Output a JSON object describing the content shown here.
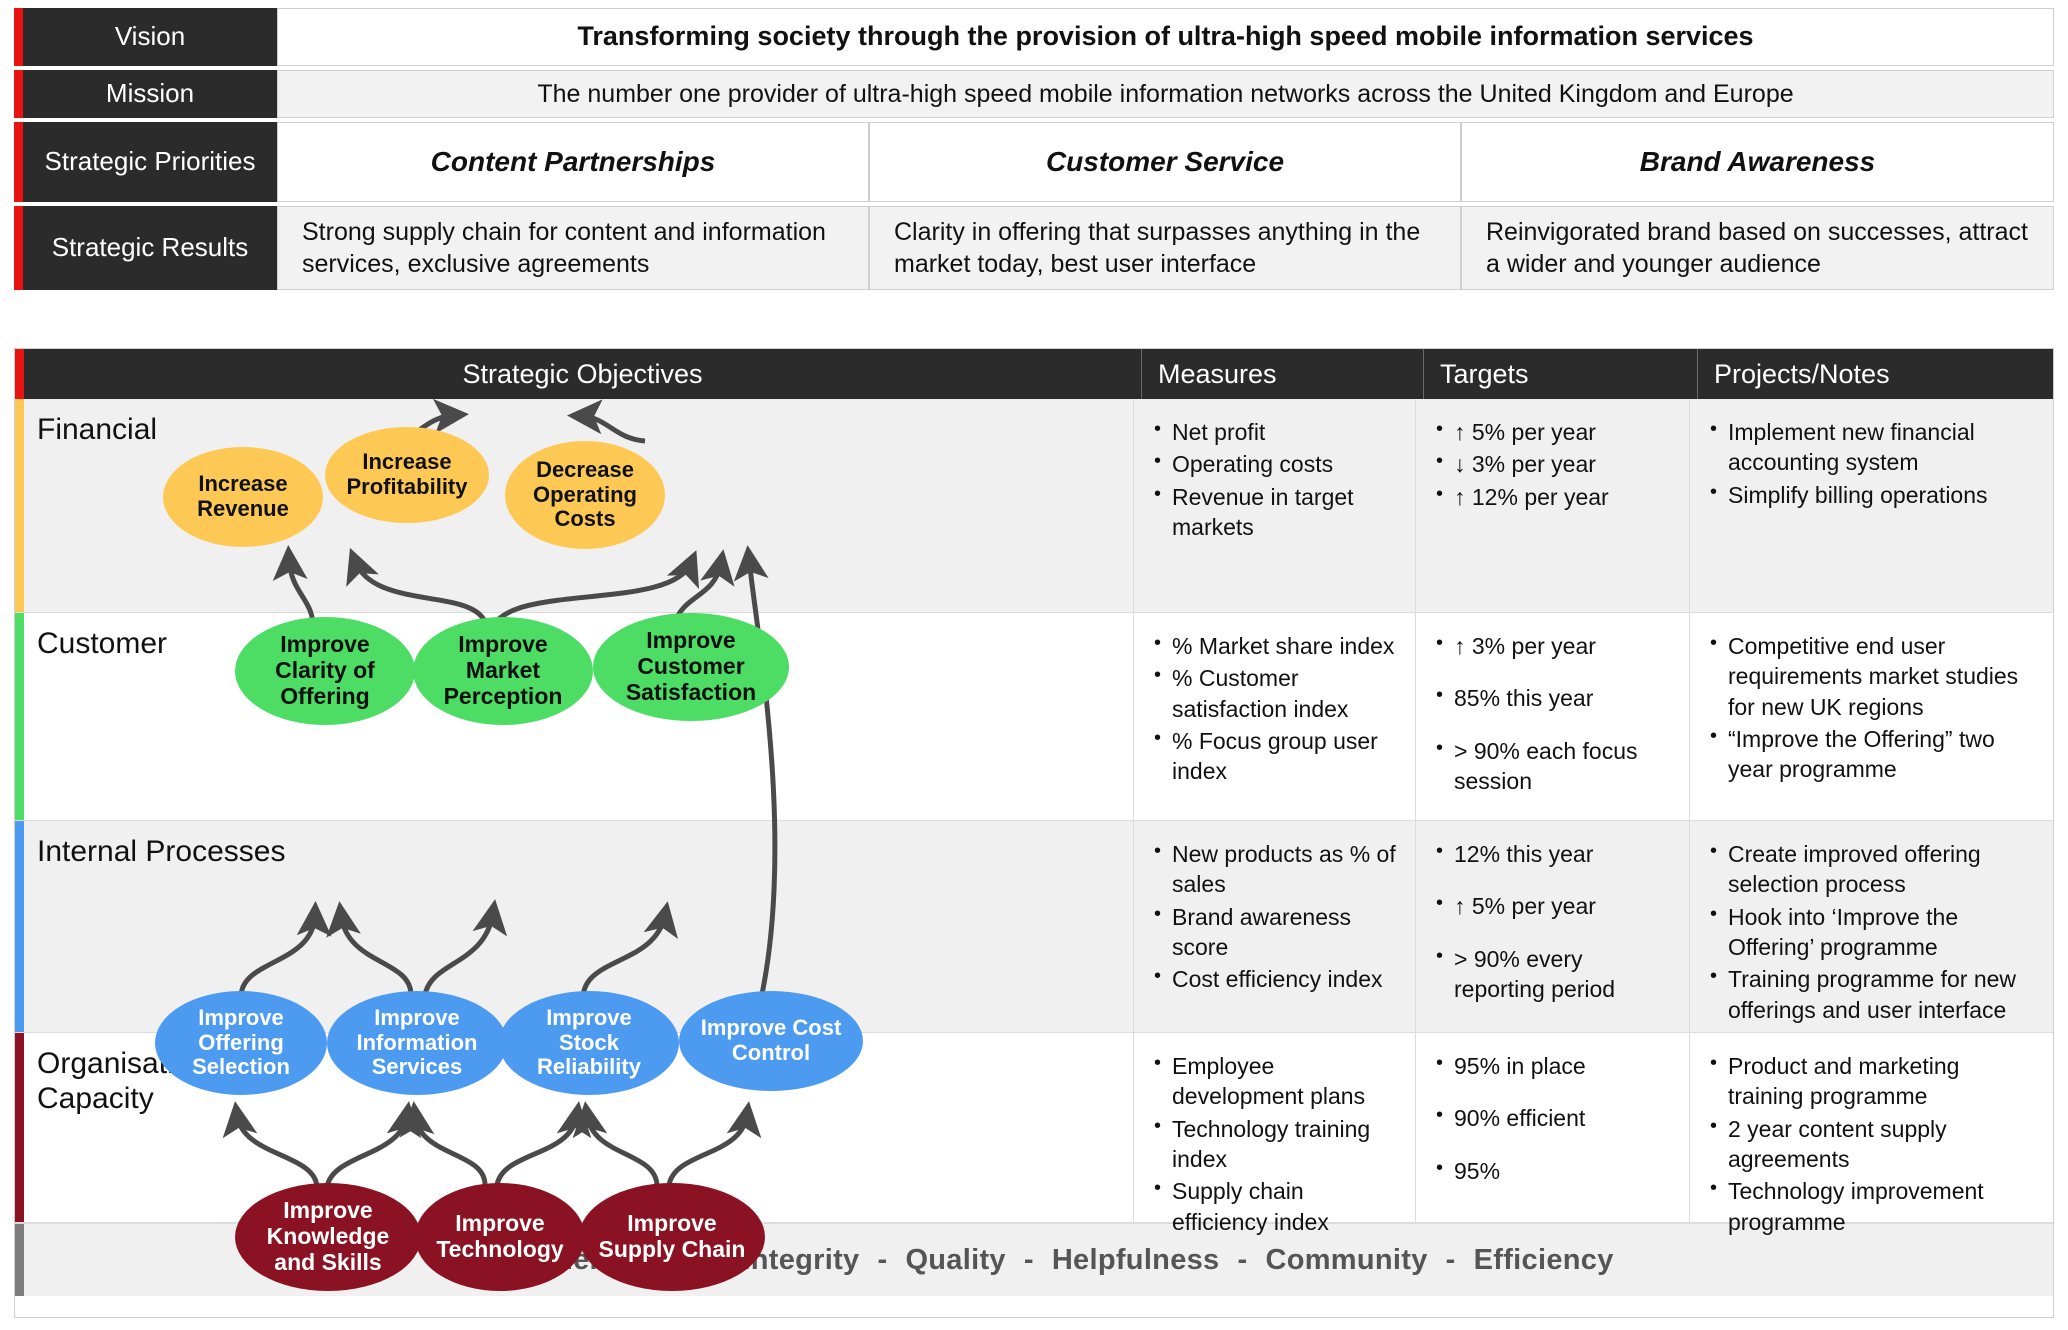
{
  "header": {
    "vision": {
      "label": "Vision",
      "text": "Transforming society through the provision of ultra-high speed mobile information services"
    },
    "mission": {
      "label": "Mission",
      "text": "The number one provider of ultra-high speed mobile information networks across the United Kingdom and Europe"
    },
    "priorities": {
      "label": "Strategic Priorities",
      "items": [
        "Content Partnerships",
        "Customer Service",
        "Brand Awareness"
      ]
    },
    "results": {
      "label": "Strategic Results",
      "items": [
        "Strong supply chain for content and information services, exclusive agreements",
        "Clarity in offering that surpasses anything in the market today, best user interface",
        "Reinvigorated brand based on successes, attract a wider and younger audience"
      ]
    }
  },
  "table": {
    "columns": [
      "Strategic Objectives",
      "Measures",
      "Targets",
      "Projects/Notes"
    ],
    "perspectives": [
      {
        "name": "Financial",
        "accent": "#fdc954",
        "measures": [
          "Net profit",
          "Operating costs",
          "Revenue in target markets"
        ],
        "targets": [
          "↑ 5% per year",
          "↓ 3% per year",
          "↑ 12% per year"
        ],
        "notes": [
          "Implement new financial accounting system",
          "Simplify billing operations"
        ]
      },
      {
        "name": "Customer",
        "accent": "#4ddc64",
        "measures": [
          "% Market share index",
          "% Customer satisfaction index",
          "% Focus group user index"
        ],
        "targets": [
          "↑ 3% per year",
          "85% this year",
          "> 90% each focus session"
        ],
        "notes": [
          "Competitive end user requirements market studies for new UK regions",
          "“Improve the Offering” two year programme"
        ]
      },
      {
        "name": "Internal Processes",
        "accent": "#4d9bf0",
        "measures": [
          "New products as % of sales",
          "Brand awareness score",
          "Cost efficiency index"
        ],
        "targets": [
          "12% this year",
          "↑ 5% per year",
          "> 90% every reporting period"
        ],
        "notes": [
          "Create improved offering selection process",
          "Hook into ‘Improve the Offering’ programme",
          "Training programme for new offerings and user interface"
        ]
      },
      {
        "name": "Organisational Capacity",
        "accent": "#8b1222",
        "measures": [
          "Employee development plans",
          "Technology training index",
          "Supply chain efficiency index"
        ],
        "targets": [
          "95% in place",
          "90% efficient",
          "95%"
        ],
        "notes": [
          "Product and marketing training programme",
          "2 year content supply agreements",
          "Technology improvement programme"
        ]
      }
    ]
  },
  "strategy_map": {
    "nodes": {
      "financial": [
        "Increase Revenue",
        "Increase Profitability",
        "Decrease Operating Costs"
      ],
      "customer": [
        "Improve Clarity of Offering",
        "Improve Market Perception",
        "Improve Customer Satisfaction"
      ],
      "internal": [
        "Improve Offering Selection",
        "Improve Information Services",
        "Improve Stock Reliability",
        "Improve Cost Control"
      ],
      "organisational": [
        "Improve Knowledge and Skills",
        "Improve Technology",
        "Improve Supply Chain"
      ]
    }
  },
  "values_bar": {
    "items": [
      "Customer Focus",
      "Integrity",
      "Quality",
      "Helpfulness",
      "Community",
      "Efficiency"
    ],
    "separator": "-"
  },
  "colors": {
    "header_accent": "#e81313",
    "label_bg": "#2b2b2b",
    "footer_accent": "#7d7d7d",
    "arrow": "#4a4a4a"
  }
}
